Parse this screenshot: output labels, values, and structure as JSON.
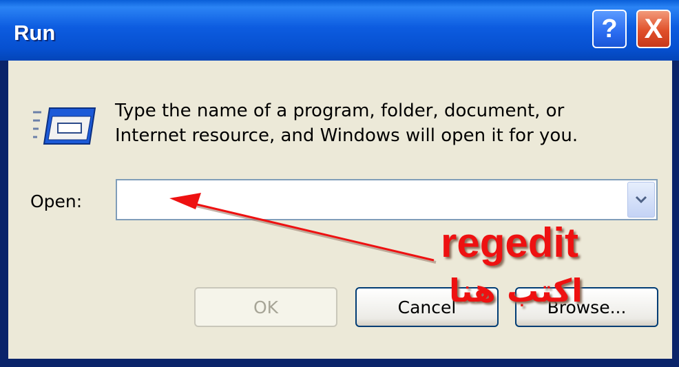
{
  "window": {
    "title": "Run",
    "help_button": "?",
    "close_button": "X"
  },
  "dialog": {
    "description_line1": "Type the name of a program, folder, document, or",
    "description_line2": "Internet resource, and Windows will open it for you.",
    "open_label": "Open:",
    "open_value": "",
    "icon": "run-window-icon",
    "dropdown_icon": "chevron-down-icon"
  },
  "buttons": {
    "ok": "OK",
    "cancel": "Cancel",
    "browse": "Browse..."
  },
  "annotation": {
    "command": "regedit",
    "instruction": "اكتب هنا",
    "arrow_color": "#ee1111",
    "text_color": "#ee1111"
  }
}
